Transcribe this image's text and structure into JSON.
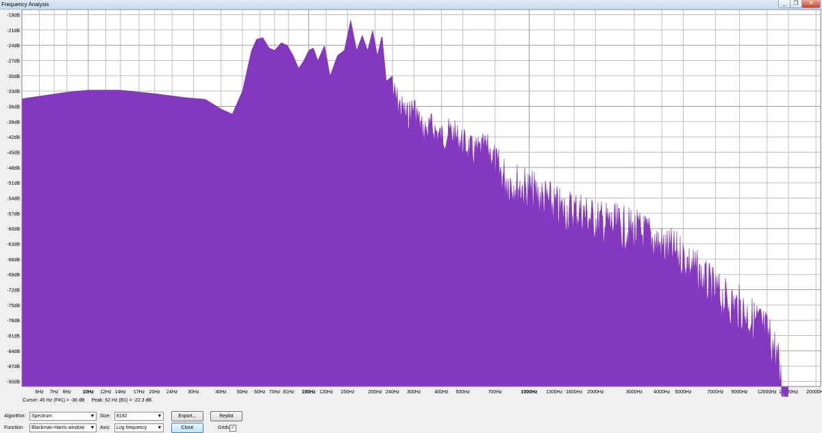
{
  "window": {
    "title": "Frequency Analysis",
    "min": "_",
    "restore": "❐",
    "close": "✕"
  },
  "colors": {
    "spectrum": "#8438c0",
    "grid": "#bdbdbd",
    "grid_major": "#9a9a9a",
    "plot_bg": "#ffffff"
  },
  "status": {
    "cursor": "Cursor: 45 Hz (F#1) = -36 dB",
    "peak": "Peak: 62 Hz (B1) = -22.3 dB"
  },
  "controls": {
    "algorithm_label": "Algorithm:",
    "algorithm_value": "Spectrum",
    "size_label": "Size:",
    "size_value": "8192",
    "function_label": "Function:",
    "function_value": "Blackman-Harris window",
    "axis_label": "Axis:",
    "axis_value": "Log frequency",
    "export_label": "Export...",
    "replot_label": "Replot",
    "close_label": "Close",
    "grids_label": "Grids",
    "grids_checked": "✓"
  },
  "chart_data": {
    "type": "area",
    "xscale": "log",
    "xlim": [
      5,
      21000
    ],
    "ylim": [
      -91,
      -17
    ],
    "grid": true,
    "x_ticks": [
      {
        "v": 6,
        "label": "6Hz"
      },
      {
        "v": 7,
        "label": "7Hz"
      },
      {
        "v": 8,
        "label": "8Hz"
      },
      {
        "v": 10,
        "label": "10Hz",
        "major": true
      },
      {
        "v": 12,
        "label": "12Hz"
      },
      {
        "v": 14,
        "label": "14Hz"
      },
      {
        "v": 17,
        "label": "17Hz"
      },
      {
        "v": 20,
        "label": "20Hz"
      },
      {
        "v": 24,
        "label": "24Hz"
      },
      {
        "v": 30,
        "label": "30Hz"
      },
      {
        "v": 40,
        "label": "40Hz"
      },
      {
        "v": 50,
        "label": "50Hz"
      },
      {
        "v": 60,
        "label": "60Hz"
      },
      {
        "v": 70,
        "label": "70Hz"
      },
      {
        "v": 81,
        "label": "81Hz"
      },
      {
        "v": 100,
        "label": "100Hz",
        "major": true
      },
      {
        "v": 120,
        "label": "120Hz"
      },
      {
        "v": 150,
        "label": "150Hz"
      },
      {
        "v": 200,
        "label": "200Hz"
      },
      {
        "v": 240,
        "label": "240Hz"
      },
      {
        "v": 300,
        "label": "300Hz"
      },
      {
        "v": 400,
        "label": "400Hz"
      },
      {
        "v": 500,
        "label": "500Hz"
      },
      {
        "v": 700,
        "label": "700Hz"
      },
      {
        "v": 1000,
        "label": "1000Hz",
        "major": true
      },
      {
        "v": 1300,
        "label": "1300Hz"
      },
      {
        "v": 1600,
        "label": "1600Hz"
      },
      {
        "v": 2000,
        "label": "2000Hz"
      },
      {
        "v": 3000,
        "label": "3000Hz"
      },
      {
        "v": 4000,
        "label": "4000Hz"
      },
      {
        "v": 5000,
        "label": "5000Hz"
      },
      {
        "v": 7000,
        "label": "7000Hz"
      },
      {
        "v": 9000,
        "label": "9000Hz"
      },
      {
        "v": 12000,
        "label": "12000Hz"
      },
      {
        "v": 15000,
        "label": "15000Hz"
      },
      {
        "v": 20000,
        "label": "20000Hz"
      }
    ],
    "y_ticks": [
      {
        "v": -18,
        "label": "-18dB"
      },
      {
        "v": -21,
        "label": "-21dB"
      },
      {
        "v": -24,
        "label": "-24dB",
        "major": true
      },
      {
        "v": -27,
        "label": "-27dB"
      },
      {
        "v": -30,
        "label": "-30dB"
      },
      {
        "v": -33,
        "label": "-33dB"
      },
      {
        "v": -36,
        "label": "-36dB",
        "major": true
      },
      {
        "v": -39,
        "label": "-39dB"
      },
      {
        "v": -42,
        "label": "-42dB"
      },
      {
        "v": -45,
        "label": "-45dB"
      },
      {
        "v": -48,
        "label": "-48dB",
        "major": true
      },
      {
        "v": -51,
        "label": "-51dB"
      },
      {
        "v": -54,
        "label": "-54dB"
      },
      {
        "v": -57,
        "label": "-57dB"
      },
      {
        "v": -60,
        "label": "-60dB",
        "major": true
      },
      {
        "v": -63,
        "label": "-63dB"
      },
      {
        "v": -66,
        "label": "-66dB"
      },
      {
        "v": -69,
        "label": "-69dB"
      },
      {
        "v": -72,
        "label": "-72dB",
        "major": true
      },
      {
        "v": -75,
        "label": "-75dB"
      },
      {
        "v": -78,
        "label": "-78dB"
      },
      {
        "v": -81,
        "label": "-81dB"
      },
      {
        "v": -84,
        "label": "-84dB",
        "major": true
      },
      {
        "v": -87,
        "label": "-87dB"
      },
      {
        "v": -90,
        "label": "-90dB"
      }
    ],
    "series": [
      {
        "x": [
          5,
          6,
          8,
          10,
          14,
          20,
          28,
          34,
          40,
          45,
          50,
          55,
          58,
          62,
          66,
          70,
          75,
          80,
          85,
          90,
          95,
          100,
          105,
          110,
          118,
          125,
          135,
          145,
          155,
          165,
          175,
          185,
          195,
          205,
          215,
          225,
          240,
          260,
          280,
          300,
          330,
          360,
          400,
          440,
          500,
          560,
          640,
          720,
          800,
          900,
          1000,
          1200,
          1400,
          1700,
          2000,
          2500,
          3000,
          3500,
          4000,
          5000,
          6000,
          7000,
          8000,
          9000,
          10000,
          11000,
          12000,
          13000,
          13500,
          14000,
          14500,
          15000
        ],
        "y": [
          -34.5,
          -34,
          -33.2,
          -32.8,
          -32.8,
          -33.5,
          -34.3,
          -34.6,
          -36.5,
          -37.5,
          -33,
          -25,
          -22.8,
          -22.5,
          -24.5,
          -25,
          -23.5,
          -24,
          -26,
          -28.5,
          -27,
          -25,
          -24.5,
          -27,
          -24,
          -30,
          -26,
          -25,
          -19,
          -25,
          -22,
          -25,
          -21,
          -26,
          -22,
          -31,
          -30,
          -33,
          -35,
          -33,
          -38,
          -37,
          -39,
          -38,
          -40,
          -42,
          -41,
          -44,
          -46,
          -47,
          -48,
          -50,
          -52,
          -52,
          -54,
          -55,
          -56,
          -57,
          -59,
          -61,
          -65,
          -68,
          -70,
          -71,
          -73,
          -74,
          -76,
          -79,
          -82,
          -86,
          -89,
          -91
        ]
      }
    ]
  }
}
